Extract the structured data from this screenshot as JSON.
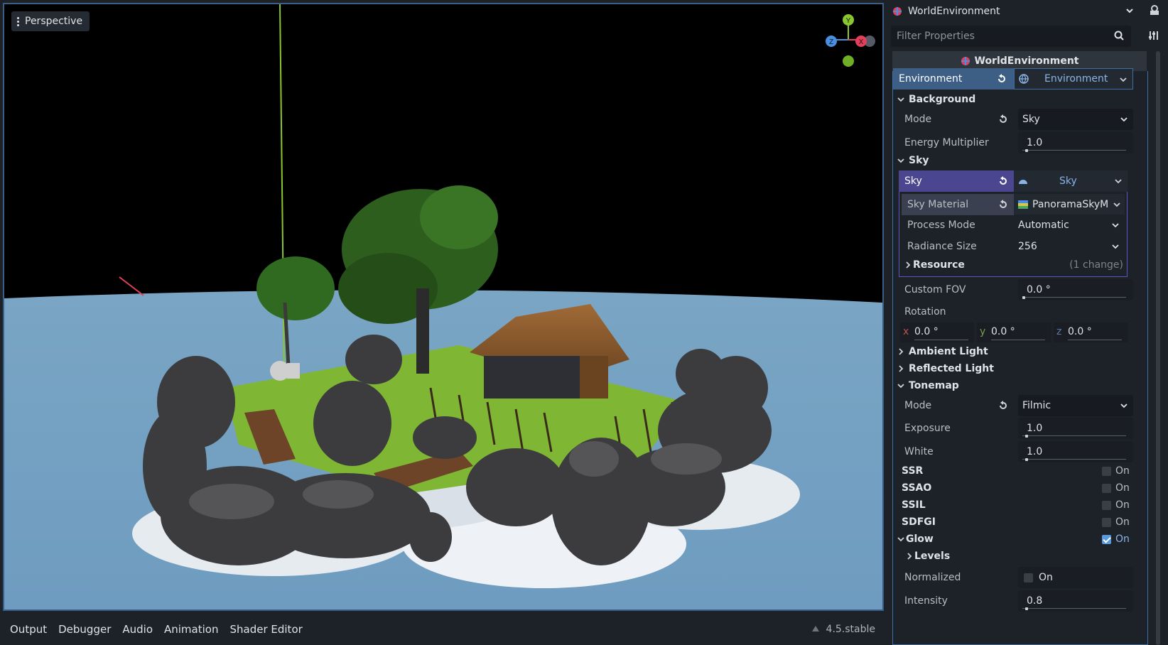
{
  "viewport": {
    "mode_label": "Perspective",
    "gizmo_axes": {
      "y": "Y",
      "z": "Z",
      "x": "X"
    }
  },
  "bottom_tabs": [
    "Output",
    "Debugger",
    "Audio",
    "Animation",
    "Shader Editor"
  ],
  "version": "4.5.stable",
  "inspector": {
    "node_name": "WorldEnvironment",
    "filter_placeholder": "Filter Properties",
    "object_title": "WorldEnvironment",
    "environment": {
      "label": "Environment",
      "value": "Environment"
    },
    "background": {
      "title": "Background",
      "mode_label": "Mode",
      "mode_value": "Sky",
      "energy_label": "Energy Multiplier",
      "energy_value": "1.0"
    },
    "sky": {
      "title": "Sky",
      "sky_label": "Sky",
      "sky_value": "Sky",
      "sky_material_label": "Sky Material",
      "sky_material_value": "PanoramaSkyM",
      "process_mode_label": "Process Mode",
      "process_mode_value": "Automatic",
      "radiance_label": "Radiance Size",
      "radiance_value": "256",
      "resource_label": "Resource",
      "resource_changes": "(1 change)",
      "custom_fov_label": "Custom FOV",
      "custom_fov_value": "0.0 °",
      "rotation_label": "Rotation",
      "rotation": {
        "x_label": "x",
        "x": "0.0 °",
        "y_label": "y",
        "y": "0.0 °",
        "z_label": "z",
        "z": "0.0 °"
      }
    },
    "ambient_light": "Ambient Light",
    "reflected_light": "Reflected Light",
    "tonemap": {
      "title": "Tonemap",
      "mode_label": "Mode",
      "mode_value": "Filmic",
      "exposure_label": "Exposure",
      "exposure_value": "1.0",
      "white_label": "White",
      "white_value": "1.0"
    },
    "toggles": [
      {
        "label": "SSR",
        "state": "On",
        "checked": false
      },
      {
        "label": "SSAO",
        "state": "On",
        "checked": false
      },
      {
        "label": "SSIL",
        "state": "On",
        "checked": false
      },
      {
        "label": "SDFGI",
        "state": "On",
        "checked": false
      }
    ],
    "glow": {
      "title": "Glow",
      "state": "On",
      "checked": true,
      "levels_label": "Levels",
      "normalized_label": "Normalized",
      "normalized_state": "On",
      "intensity_label": "Intensity",
      "intensity_value": "0.8"
    }
  },
  "colors": {
    "accent_blue": "#3b6fa5",
    "environment_row": "#3d5f86",
    "sky_row": "#4a4790",
    "sky_material_row": "#3a4050",
    "axis_y": "#8ac62f",
    "axis_x": "#e2405a",
    "axis_z": "#4a8ee0",
    "checkbox_on": "#5a9be0"
  }
}
